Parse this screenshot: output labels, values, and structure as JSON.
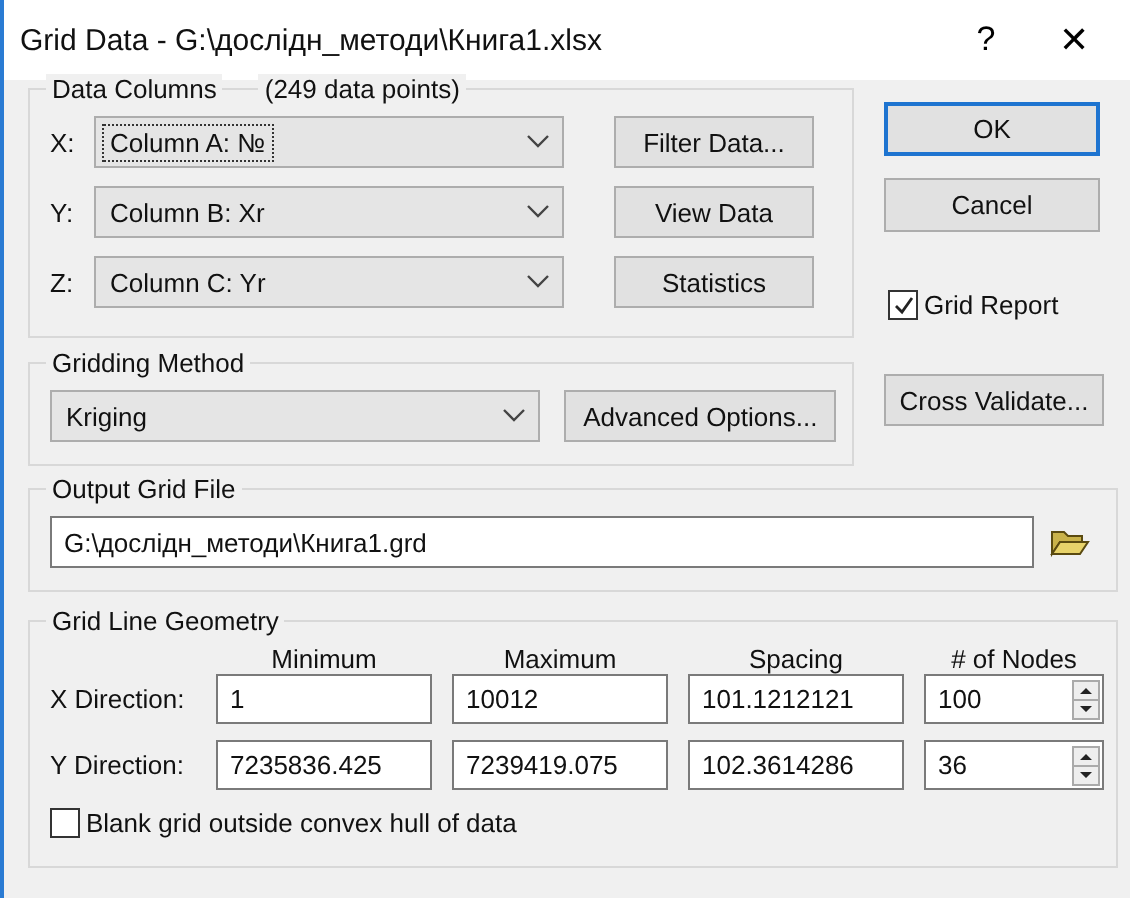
{
  "window": {
    "title": "Grid Data - G:\\дослідн_методи\\Книга1.xlsx",
    "help": "?",
    "close": "✕"
  },
  "data_columns": {
    "title": "Data Columns",
    "count": "(249 data points)",
    "rows": [
      {
        "label": "X:",
        "value": "Column A:  №",
        "focused": true,
        "button": "Filter Data..."
      },
      {
        "label": "Y:",
        "value": "Column B:  Xr",
        "focused": false,
        "button": "View Data"
      },
      {
        "label": "Z:",
        "value": "Column C:  Yr",
        "focused": false,
        "button": "Statistics"
      }
    ]
  },
  "dialog_buttons": [
    {
      "label": "OK",
      "default": true
    },
    {
      "label": "Cancel",
      "default": false
    }
  ],
  "grid_report": {
    "label": "Grid Report",
    "checked": true
  },
  "gridding_method": {
    "title": "Gridding Method",
    "value": "Kriging",
    "button": "Advanced Options..."
  },
  "cross_validate": "Cross Validate...",
  "output_grid_file": {
    "title": "Output Grid File",
    "value": "G:\\дослідн_методи\\Книга1.grd"
  },
  "grid_line_geometry": {
    "title": "Grid Line Geometry",
    "columns": [
      "Minimum",
      "Maximum",
      "Spacing",
      "# of Nodes"
    ],
    "rows": [
      {
        "label": "X Direction:",
        "values": [
          "1",
          "10012",
          "101.1212121",
          "100"
        ]
      },
      {
        "label": "Y Direction:",
        "values": [
          "7235836.425",
          "7239419.075",
          "102.3614286",
          "36"
        ]
      }
    ],
    "blank_grid": {
      "label": "Blank grid outside convex hull of data",
      "checked": false
    }
  }
}
